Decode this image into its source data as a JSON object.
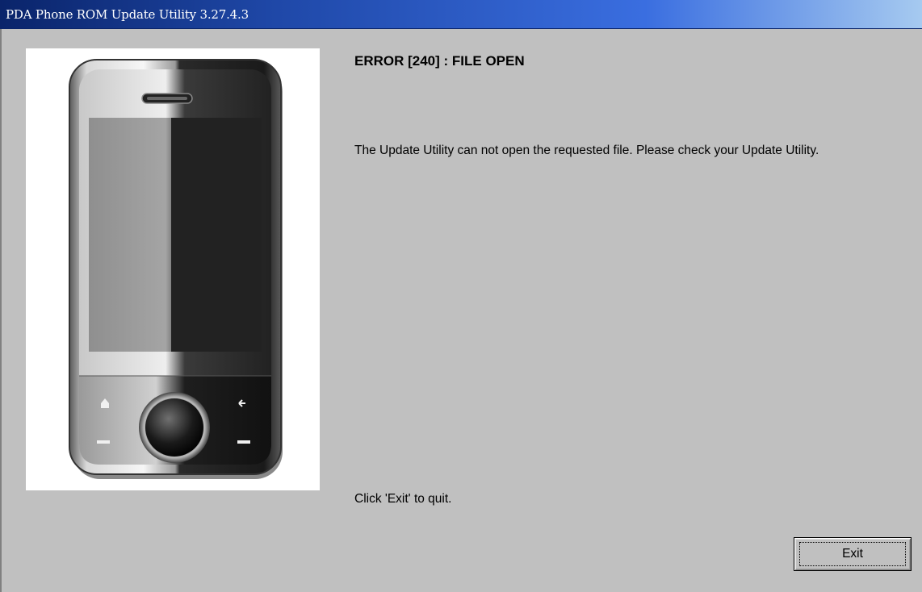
{
  "window": {
    "title": "PDA Phone ROM Update Utility 3.27.4.3",
    "titlebar_gradient": [
      "#0a246a",
      "#a6caf0"
    ],
    "background": "#c0c0c0"
  },
  "error": {
    "title": "ERROR [240] : FILE OPEN",
    "message": "The Update Utility can not open the requested file. Please check your Update Utility.",
    "hint": "Click 'Exit' to quit."
  },
  "buttons": {
    "exit_label": "Exit"
  },
  "phone_image": {
    "icons": [
      "home-icon",
      "back-icon",
      "call-icon",
      "end-call-icon",
      "earpiece-speaker"
    ]
  }
}
